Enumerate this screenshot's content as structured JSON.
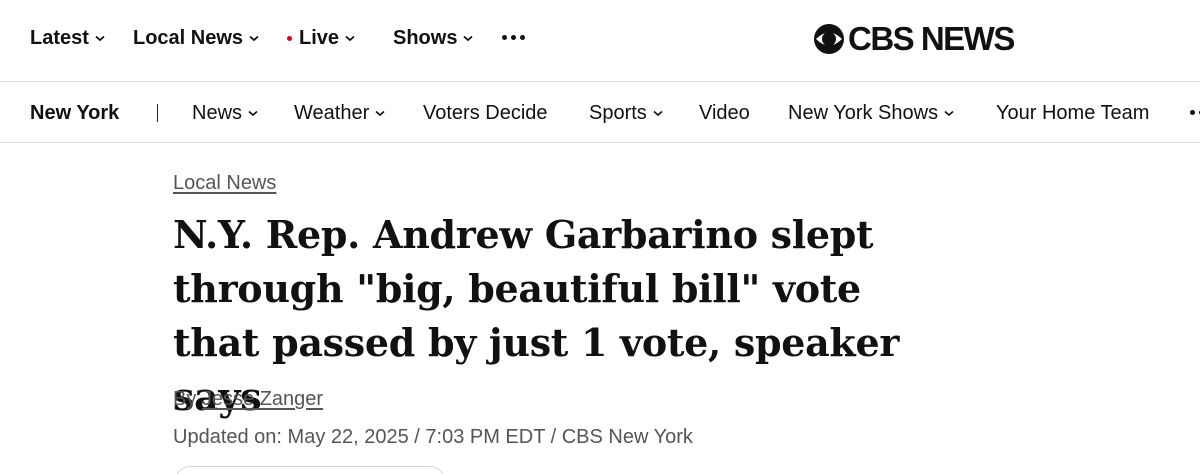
{
  "top_nav": {
    "items": [
      {
        "label": "Latest"
      },
      {
        "label": "Local News"
      },
      {
        "label": "Live"
      },
      {
        "label": "Shows"
      }
    ],
    "more_icon": "more-horizontal-icon",
    "live_dot_color": "#d0021b"
  },
  "logo": {
    "text": "CBS NEWS",
    "icon": "cbs-eye-icon"
  },
  "section_nav": {
    "title": "New York",
    "divider": "|",
    "items": [
      {
        "label": "News"
      },
      {
        "label": "Weather"
      },
      {
        "label": "Voters Decide"
      },
      {
        "label": "Sports"
      },
      {
        "label": "Video"
      },
      {
        "label": "New York Shows"
      },
      {
        "label": "Your Home Team"
      }
    ]
  },
  "article": {
    "kicker": "Local News",
    "headline": "N.Y. Rep. Andrew Garbarino slept through \"big, beautiful bill\" vote that passed by just 1 vote, speaker says",
    "byline_prefix": "By",
    "author": "Jesse Zanger",
    "updated": "Updated on: May 22, 2025 / 7:03 PM EDT / CBS New York"
  }
}
